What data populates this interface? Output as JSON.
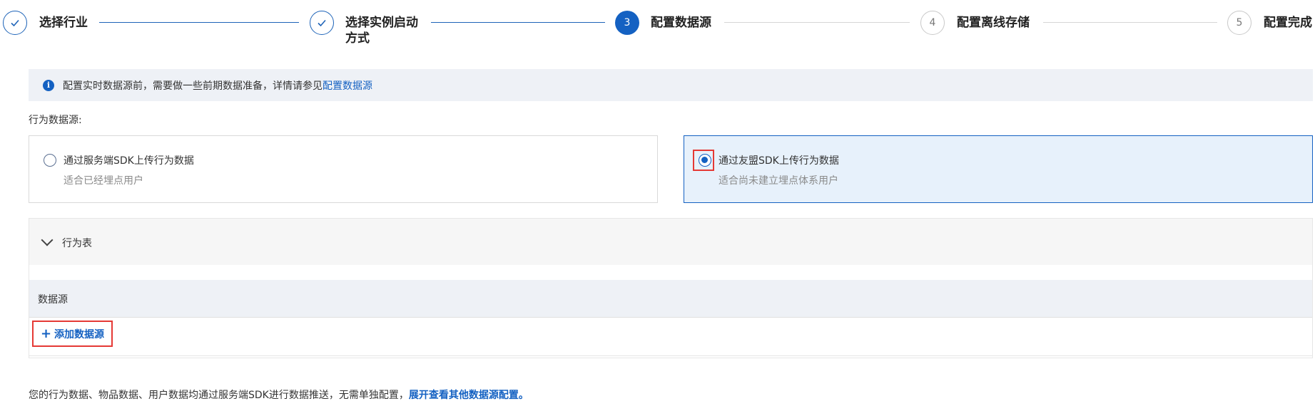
{
  "steps": [
    {
      "title": "选择行业",
      "status": "done",
      "icon": "check-icon"
    },
    {
      "title_line1": "选择实例启动",
      "title_line2": "方式",
      "status": "done",
      "icon": "check-icon"
    },
    {
      "number": "3",
      "title": "配置数据源",
      "status": "active"
    },
    {
      "number": "4",
      "title": "配置离线存储",
      "status": "todo"
    },
    {
      "number": "5",
      "title": "配置完成",
      "status": "todo"
    }
  ],
  "banner": {
    "icon": "info-icon",
    "text": "配置实时数据源前，需要做一些前期数据准备，详情请参见",
    "link": "配置数据源"
  },
  "behavior_source_label": "行为数据源:",
  "options": [
    {
      "title": "通过服务端SDK上传行为数据",
      "desc": "适合已经埋点用户",
      "selected": false
    },
    {
      "title": "通过友盟SDK上传行为数据",
      "desc": "适合尚未建立埋点体系用户",
      "selected": true
    }
  ],
  "panel": {
    "title": "行为表",
    "column_header": "数据源",
    "add_button": "添加数据源"
  },
  "footer": {
    "text": "您的行为数据、物品数据、用户数据均通过服务端SDK进行数据推送，无需单独配置，",
    "link": "展开查看其他数据源配置。"
  },
  "colors": {
    "primary": "#1461c2",
    "highlight": "#e53935",
    "selected_bg": "#e7f1fb"
  }
}
